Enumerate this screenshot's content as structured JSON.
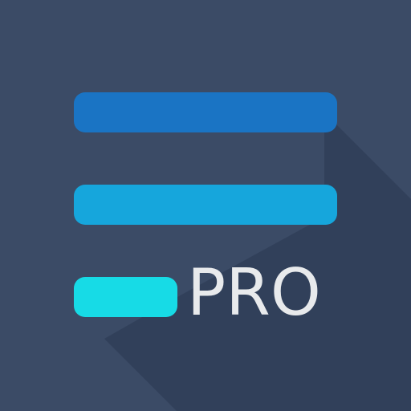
{
  "icon": {
    "label": "PRO",
    "colors": {
      "background": "#3b4b66",
      "shadow": "#31405a",
      "bar_top": "#1a74c4",
      "bar_middle": "#16a6dc",
      "bar_bottom": "#17dbe6",
      "text": "#e8eaec"
    },
    "icon_name": "list-lines-icon"
  }
}
